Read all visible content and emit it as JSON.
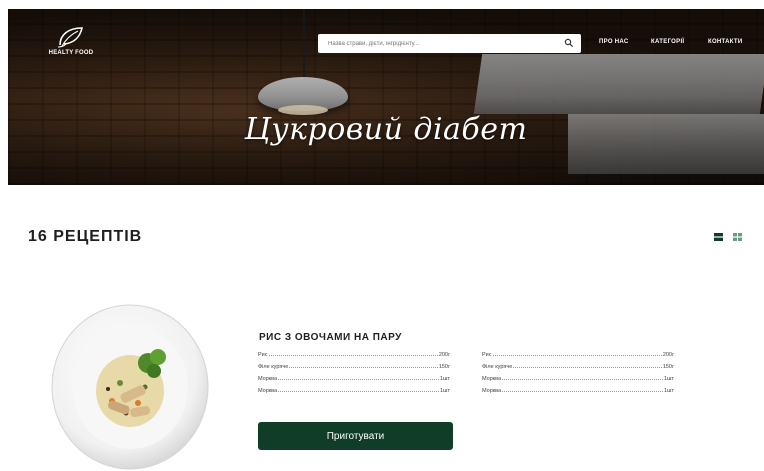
{
  "header": {
    "logo_text": "HEALTY FOOD",
    "search_placeholder": "Назва страви, дієти, інгрідієнту...",
    "nav": [
      "ПРО НАС",
      "КАТЕГОРІЇ",
      "КОНТАКТИ"
    ],
    "hero_title": "Цукровий діабет"
  },
  "main": {
    "recipes_count": "16 РЕЦЕПТІВ"
  },
  "recipe": {
    "title": "РИС З ОВОЧАМИ НА ПАРУ",
    "ingredients_left": [
      {
        "name": "Рис",
        "qty": "200г"
      },
      {
        "name": "Філе куряче",
        "qty": "150г"
      },
      {
        "name": "Морква",
        "qty": "1шт"
      },
      {
        "name": "Морква",
        "qty": "1шт"
      }
    ],
    "ingredients_right": [
      {
        "name": "Рис",
        "qty": "200г"
      },
      {
        "name": "Філе куряче",
        "qty": "150г"
      },
      {
        "name": "Морква",
        "qty": "1шт"
      },
      {
        "name": "Морква",
        "qty": "1шт"
      }
    ],
    "button_label": "Приготувати"
  },
  "colors": {
    "accent": "#0f3d28",
    "view_active": "#0f3d28",
    "view_inactive": "#6a9c7e"
  },
  "icons": [
    "leaf-logo-icon",
    "search-icon",
    "list-view-icon",
    "grid-view-icon"
  ]
}
